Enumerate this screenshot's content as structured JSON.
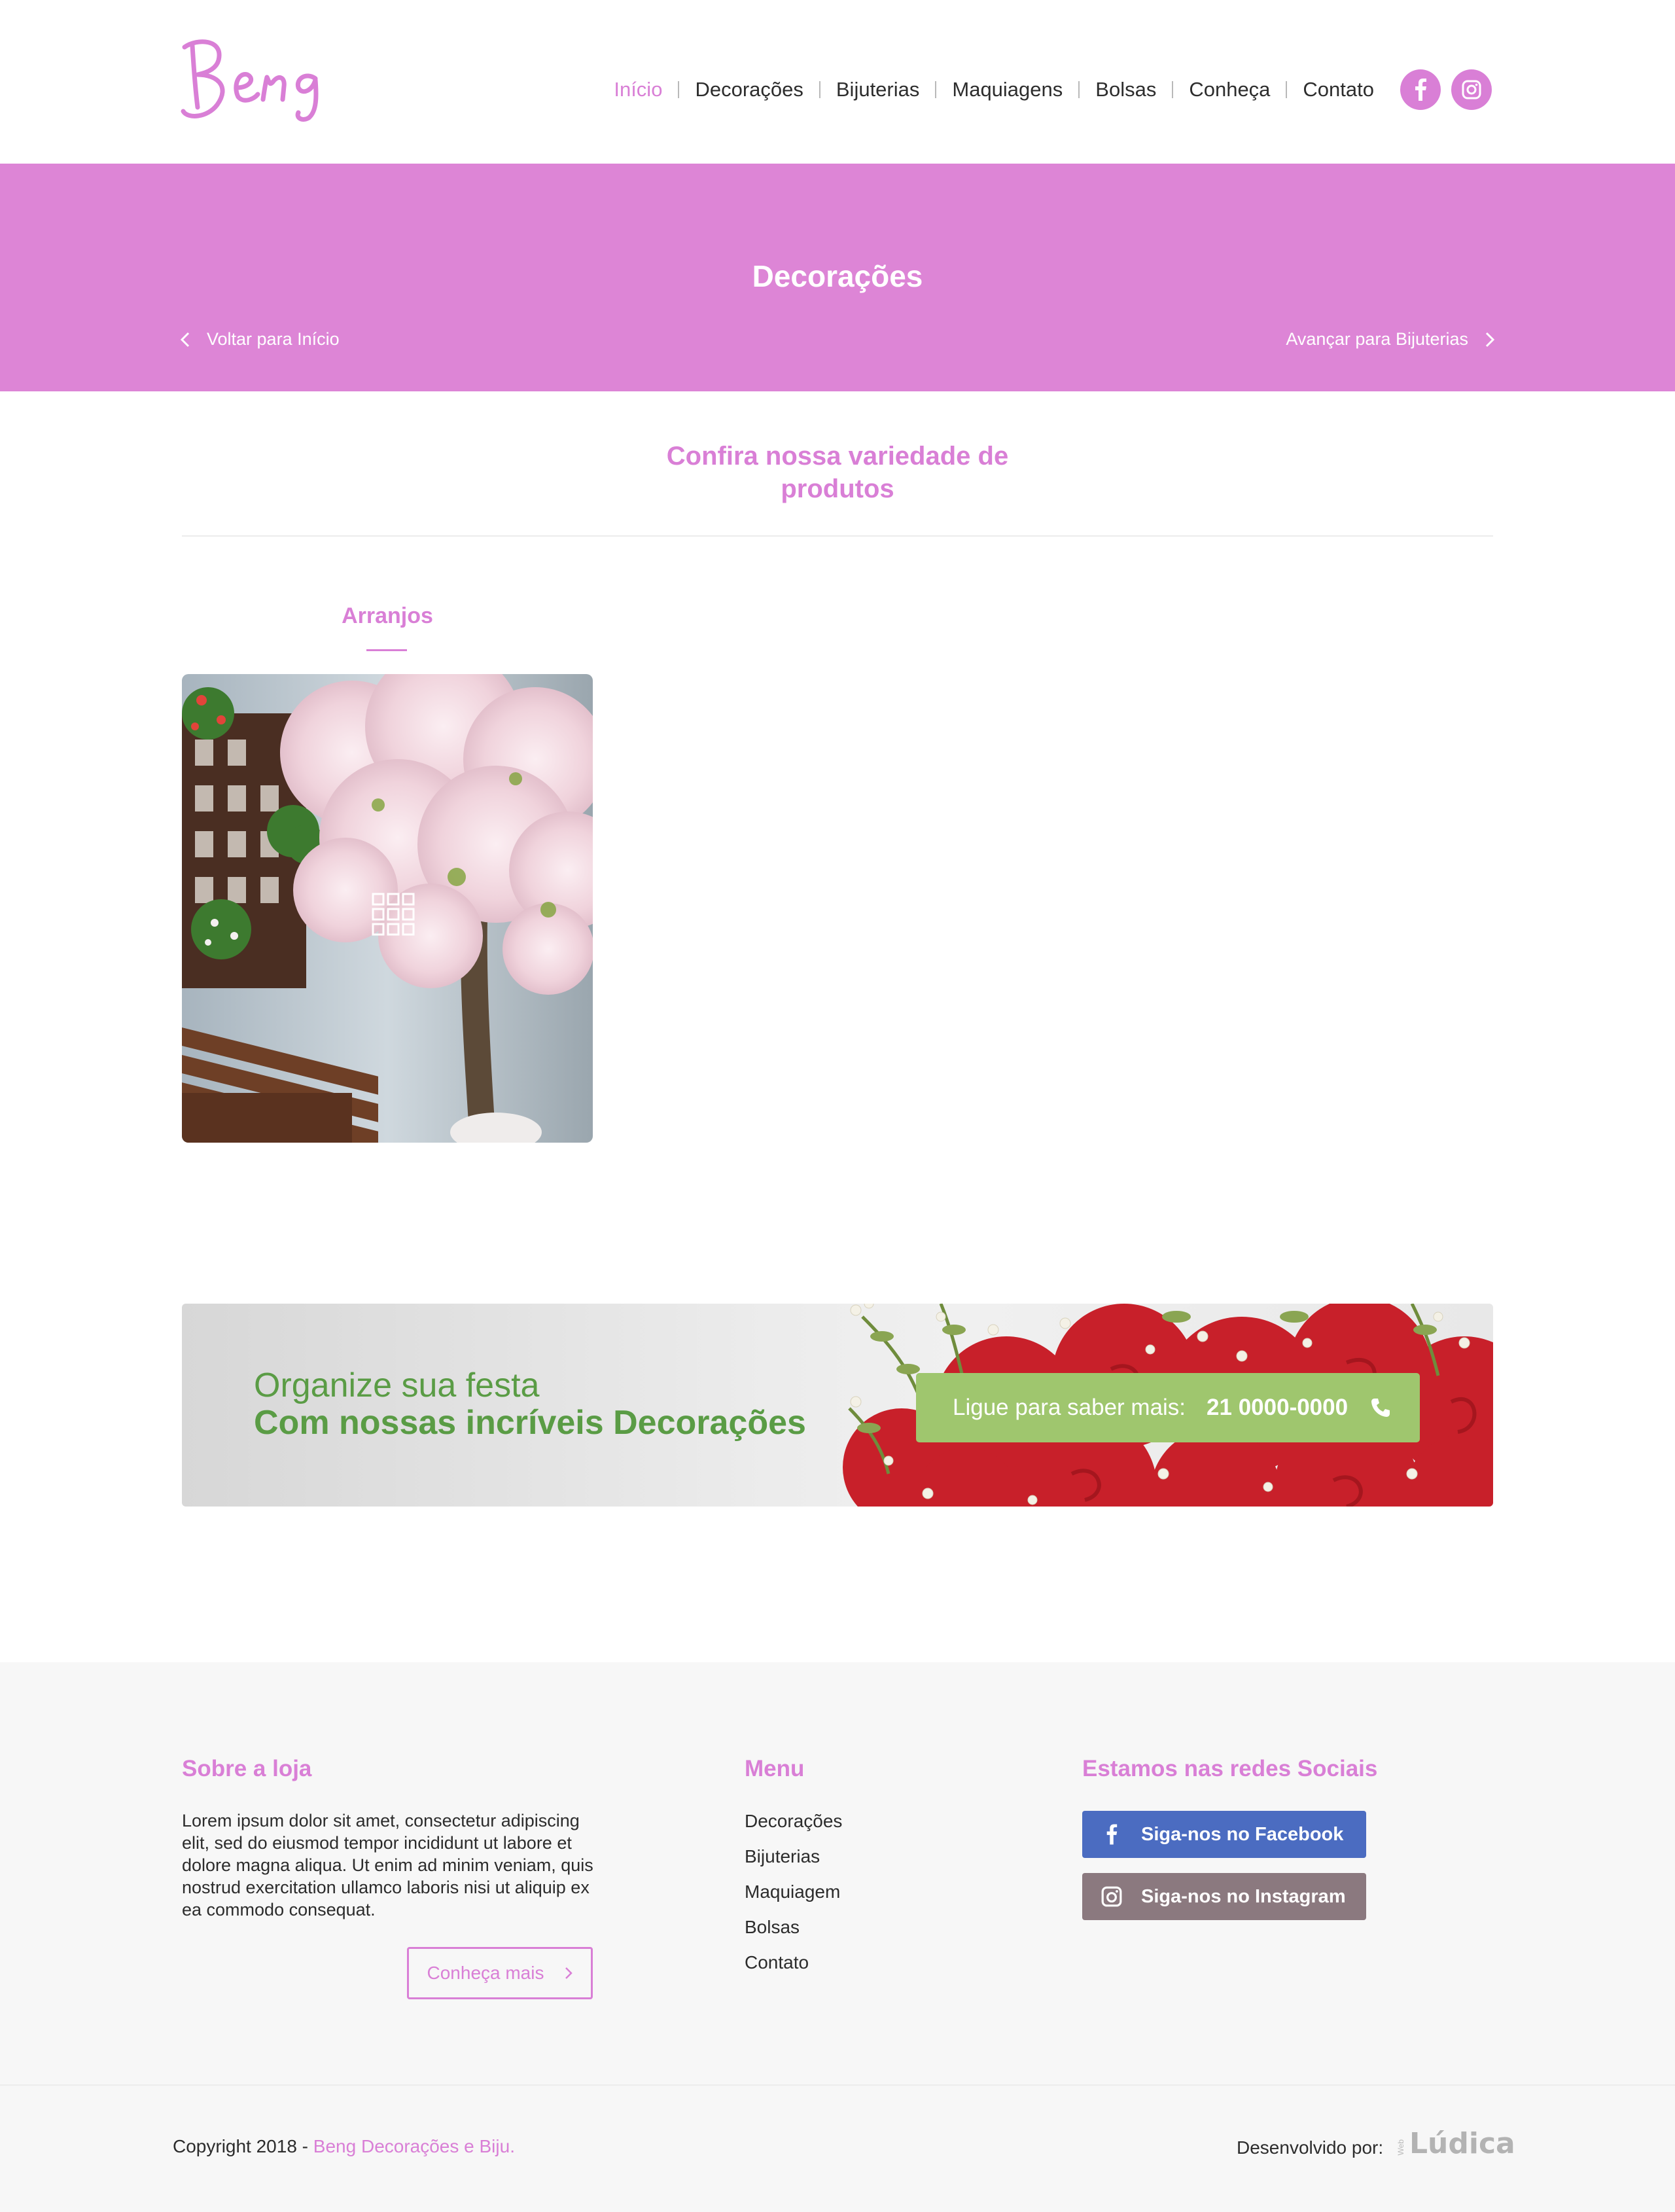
{
  "header": {
    "logo_text": "Beng",
    "nav": [
      {
        "label": "Início",
        "active": true
      },
      {
        "label": "Decorações",
        "active": false
      },
      {
        "label": "Bijuterias",
        "active": false
      },
      {
        "label": "Maquiagens",
        "active": false
      },
      {
        "label": "Bolsas",
        "active": false
      },
      {
        "label": "Conheça",
        "active": false
      },
      {
        "label": "Contato",
        "active": false
      }
    ],
    "social_icons": [
      "facebook-icon",
      "instagram-icon"
    ]
  },
  "hero": {
    "title": "Decorações",
    "back_label": "Voltar para Início",
    "next_label": "Avançar para Bijuterias"
  },
  "intro": {
    "line1": "Confira nossa variedade de",
    "line2": "produtos"
  },
  "category": {
    "title": "Arranjos",
    "image_alt": "flowering-tree-arrangement"
  },
  "promo": {
    "line1": "Organize sua festa",
    "line2": "Com nossas incríveis Decorações",
    "cta_label": "Ligue para saber mais:",
    "cta_number": "21 0000-0000"
  },
  "footer": {
    "about": {
      "title": "Sobre a loja",
      "text": "Lorem ipsum dolor sit amet, consectetur adipiscing elit, sed do eiusmod tempor incididunt ut labore et dolore magna aliqua. Ut enim ad minim veniam, quis nostrud exercitation ullamco laboris nisi ut aliquip ex ea commodo consequat.",
      "button": "Conheça mais"
    },
    "menu": {
      "title": "Menu",
      "items": [
        "Decorações",
        "Bijuterias",
        "Maquiagem",
        "Bolsas",
        "Contato"
      ]
    },
    "social": {
      "title": "Estamos nas redes Sociais",
      "facebook": "Siga-nos no Facebook",
      "instagram": "Siga-nos no Instagram"
    }
  },
  "bottom": {
    "copyright_prefix": "Copyright 2018 - ",
    "copyright_brand": "Beng Decorações e Biju.",
    "dev_label": "Desenvolvido por:",
    "dev_logo_small": "Web",
    "dev_logo": "Lúdica"
  },
  "colors": {
    "accent": "#dd85d6",
    "green": "#5a9c45",
    "cta_green": "#9fc66e",
    "facebook": "#4b6cc1",
    "instagram": "#8b797f"
  }
}
